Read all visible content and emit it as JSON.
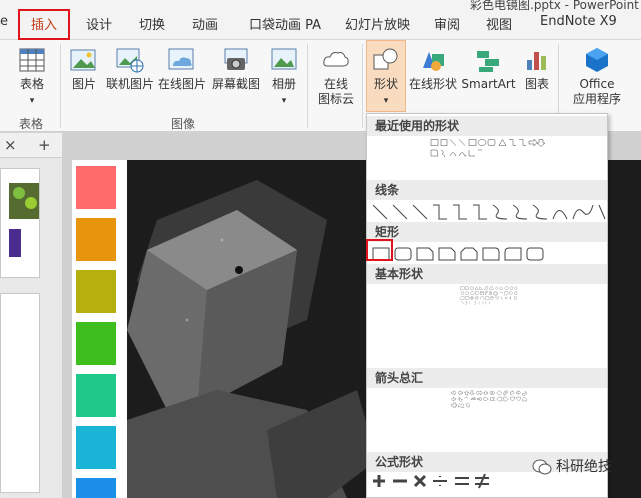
{
  "window": {
    "title": "彩色电镜图.pptx - PowerPoint"
  },
  "tabs": [
    "e",
    "插入",
    "设计",
    "切换",
    "动画",
    "口袋动画 PA",
    "幻灯片放映",
    "审阅",
    "视图",
    "EndNote X9"
  ],
  "ribbon": {
    "table_btn": "表格",
    "table_group": "表格",
    "images": [
      "图片",
      "联机图片",
      "在线图片",
      "屏幕截图",
      "相册"
    ],
    "images_group": "图像",
    "wordcloud_line1": "在线",
    "wordcloud_line2": "图标云",
    "shapes_btn": "形状",
    "online_shapes_btn": "在线形状",
    "smartart_btn": "SmartArt",
    "chart_btn": "图表",
    "office_line1": "Office",
    "office_line2": "应用程序"
  },
  "pane": {
    "close": "×",
    "add": "+"
  },
  "slide": {
    "swatch_colors": [
      "#ff6b6b",
      "#e8950e",
      "#b5b00e",
      "#3fbf1e",
      "#1ec98a",
      "#1ab5d6",
      "#1c8fe8"
    ]
  },
  "shapes_menu": {
    "sections": [
      "最近使用的形状",
      "线条",
      "矩形",
      "基本形状",
      "箭头总汇",
      "公式形状"
    ],
    "selected_shape": "rectangle"
  },
  "watermark": {
    "text": "科研绝技"
  }
}
